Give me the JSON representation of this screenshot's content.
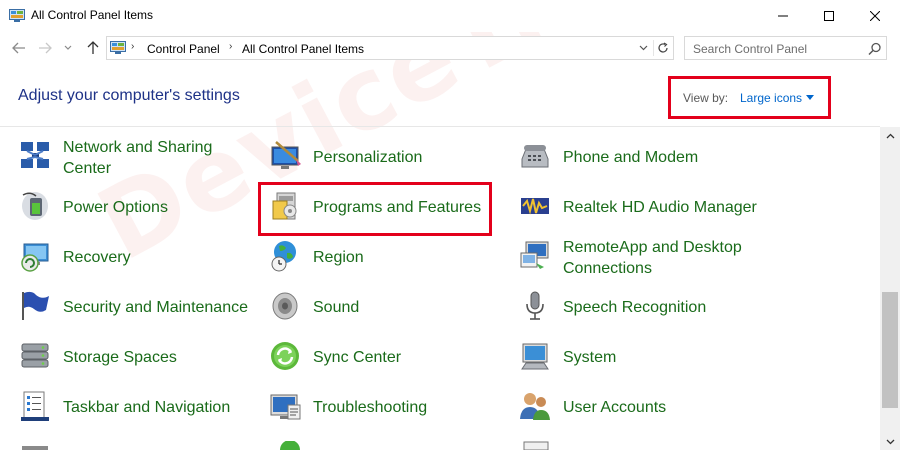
{
  "window": {
    "title": "All Control Panel Items",
    "icon": "control-panel-icon",
    "controls": [
      "minimize-icon",
      "maximize-icon",
      "close-icon"
    ]
  },
  "address": {
    "crumbs": [
      "Control Panel",
      "All Control Panel Items"
    ],
    "search_placeholder": "Search Control Panel"
  },
  "header": {
    "heading": "Adjust your computer's settings",
    "view_by_label": "View by:",
    "view_by_value": "Large icons"
  },
  "items": [
    {
      "label": "Network and Sharing Center",
      "icon": "network-icon"
    },
    {
      "label": "Personalization",
      "icon": "personalization-icon"
    },
    {
      "label": "Phone and Modem",
      "icon": "phone-icon"
    },
    {
      "label": "Power Options",
      "icon": "power-icon"
    },
    {
      "label": "Programs and Features",
      "icon": "programs-icon"
    },
    {
      "label": "Realtek HD Audio Manager",
      "icon": "audio-manager-icon"
    },
    {
      "label": "Recovery",
      "icon": "recovery-icon"
    },
    {
      "label": "Region",
      "icon": "globe-icon"
    },
    {
      "label": "RemoteApp and Desktop Connections",
      "icon": "remoteapp-icon"
    },
    {
      "label": "Security and Maintenance",
      "icon": "flag-icon"
    },
    {
      "label": "Sound",
      "icon": "speaker-icon"
    },
    {
      "label": "Speech Recognition",
      "icon": "microphone-icon"
    },
    {
      "label": "Storage Spaces",
      "icon": "storage-icon"
    },
    {
      "label": "Sync Center",
      "icon": "sync-icon"
    },
    {
      "label": "System",
      "icon": "system-icon"
    },
    {
      "label": "Taskbar and Navigation",
      "icon": "taskbar-icon"
    },
    {
      "label": "Troubleshooting",
      "icon": "troubleshooting-icon"
    },
    {
      "label": "User Accounts",
      "icon": "users-icon"
    }
  ],
  "watermark": "DeviceTricks",
  "colors": {
    "heading": "#1e3287",
    "item_label": "#1a6b1a",
    "link": "#0066cc",
    "annotation_box": "#e3001b"
  }
}
